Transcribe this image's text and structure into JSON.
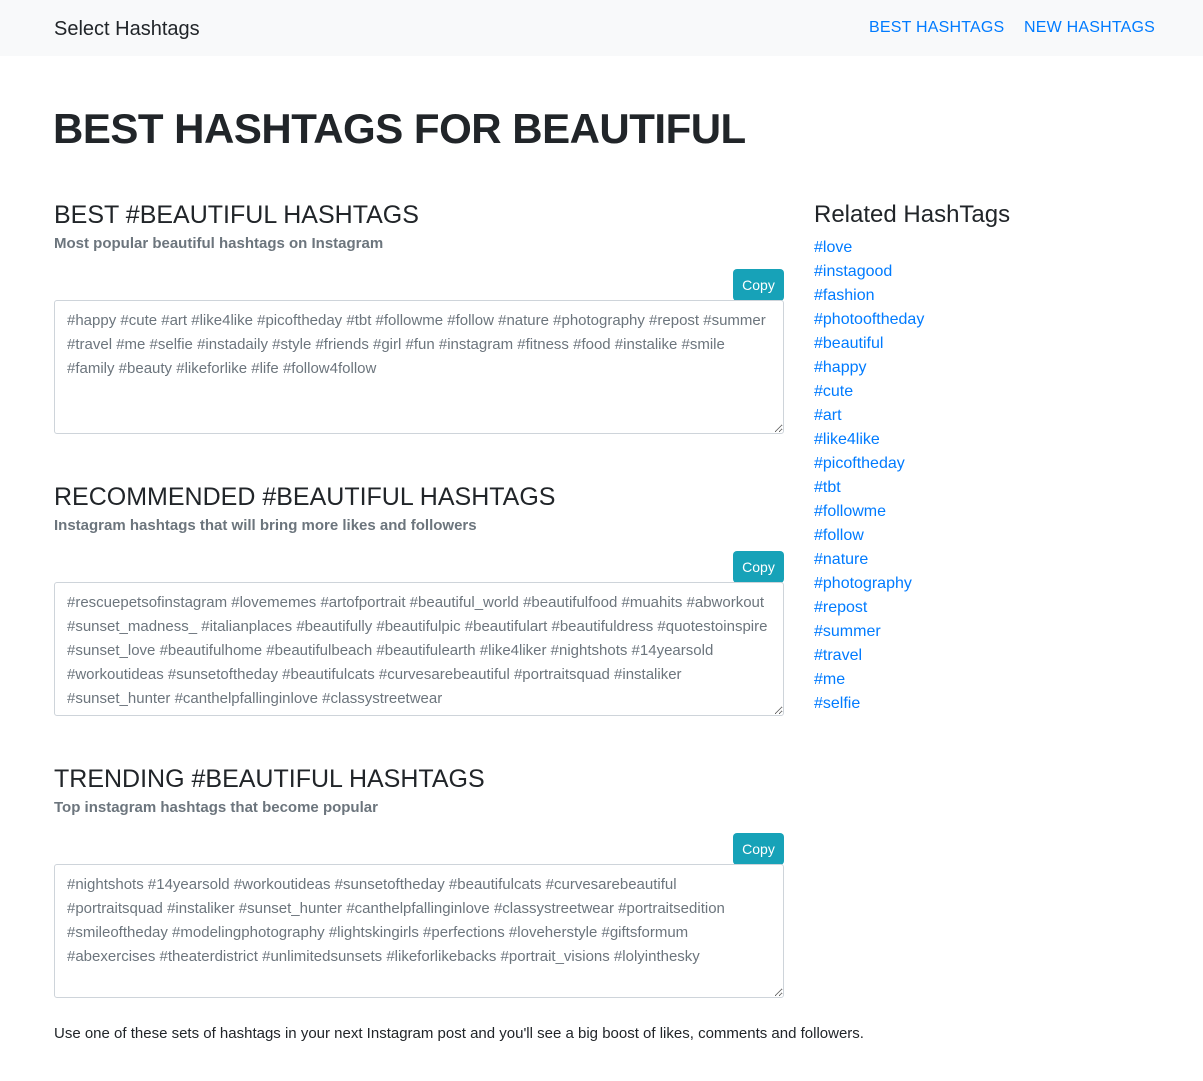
{
  "navbar": {
    "brand": "Select Hashtags",
    "links": [
      "BEST HASHTAGS",
      "NEW HASHTAGS"
    ]
  },
  "page_title": "BEST HASHTAGS FOR BEAUTIFUL",
  "sections": [
    {
      "title": "BEST #BEAUTIFUL HASHTAGS",
      "subtitle": "Most popular beautiful hashtags on Instagram",
      "copy_label": "Copy",
      "tags": "#happy #cute #art #like4like #picoftheday #tbt #followme #follow #nature #photography #repost #summer #travel #me #selfie #instadaily #style #friends #girl #fun #instagram #fitness #food #instalike #smile #family #beauty #likeforlike #life #follow4follow"
    },
    {
      "title": "RECOMMENDED #BEAUTIFUL HASHTAGS",
      "subtitle": "Instagram hashtags that will bring more likes and followers",
      "copy_label": "Copy",
      "tags": "#rescuepetsofinstagram #lovememes #artofportrait #beautiful_world #beautifulfood #muahits #abworkout #sunset_madness_ #italianplaces #beautifully #beautifulpic #beautifulart #beautifuldress #quotestoinspire #sunset_love #beautifulhome #beautifulbeach #beautifulearth #like4liker #nightshots #14yearsold #workoutideas #sunsetoftheday #beautifulcats #curvesarebeautiful #portraitsquad #instaliker #sunset_hunter #canthelpfallinginlove #classystreetwear"
    },
    {
      "title": "TRENDING #BEAUTIFUL HASHTAGS",
      "subtitle": "Top instagram hashtags that become popular",
      "copy_label": "Copy",
      "tags": "#nightshots #14yearsold #workoutideas #sunsetoftheday #beautifulcats #curvesarebeautiful #portraitsquad #instaliker #sunset_hunter #canthelpfallinginlove #classystreetwear #portraitsedition #smileoftheday #modelingphotography #lightskingirls #perfections #loveherstyle #giftsformum #abexercises #theaterdistrict #unlimitedsunsets #likeforlikebacks #portrait_visions #lolyinthesky"
    }
  ],
  "footer_text": "Use one of these sets of hashtags in your next Instagram post and you'll see a big boost of likes, comments and followers.",
  "related": {
    "title": "Related HashTags",
    "tags": [
      "#love",
      "#instagood",
      "#fashion",
      "#photooftheday",
      "#beautiful",
      "#happy",
      "#cute",
      "#art",
      "#like4like",
      "#picoftheday",
      "#tbt",
      "#followme",
      "#follow",
      "#nature",
      "#photography",
      "#repost",
      "#summer",
      "#travel",
      "#me",
      "#selfie"
    ]
  },
  "colors": {
    "link": "#007bff",
    "copy_button": "#17a2b8",
    "navbar_bg": "#f8f9fa"
  }
}
